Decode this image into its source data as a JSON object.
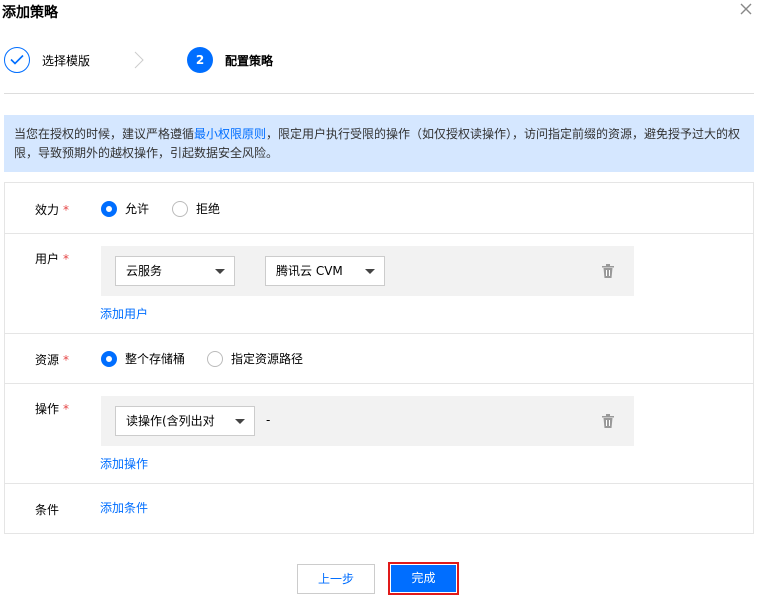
{
  "dialog": {
    "title": "添加策略",
    "close_icon": "close-icon"
  },
  "steps": [
    {
      "label": "选择模版",
      "state": "done",
      "icon": "check-icon"
    },
    {
      "number": "2",
      "label": "配置策略",
      "state": "active"
    }
  ],
  "notice": {
    "prefix": "当您在授权的时候，建议严格遵循",
    "link": "最小权限原则",
    "suffix": "，限定用户执行受限的操作（如仅授权读操作），访问指定前缀的资源，避免授予过大的权限，导致预期外的越权操作，引起数据安全风险。"
  },
  "form": {
    "effect": {
      "label": "效力",
      "required_mark": "*",
      "options": [
        {
          "label": "允许",
          "selected": true
        },
        {
          "label": "拒绝",
          "selected": false
        }
      ]
    },
    "user": {
      "label": "用户",
      "required_mark": "*",
      "select1": "云服务",
      "select2": "腾讯云 CVM",
      "add_link": "添加用户",
      "delete_icon": "trash-icon"
    },
    "resource": {
      "label": "资源",
      "required_mark": "*",
      "options": [
        {
          "label": "整个存储桶",
          "selected": true
        },
        {
          "label": "指定资源路径",
          "selected": false
        }
      ]
    },
    "action": {
      "label": "操作",
      "required_mark": "*",
      "select": "读操作(含列出对",
      "dash": "-",
      "add_link": "添加操作",
      "delete_icon": "trash-icon"
    },
    "condition": {
      "label": "条件",
      "add_link": "添加条件"
    }
  },
  "footer": {
    "prev_label": "上一步",
    "done_label": "完成"
  },
  "colors": {
    "accent": "#006eff",
    "notice_bg": "#d5e7ff",
    "required": "#e54545",
    "highlight_outline": "#e01a1a"
  }
}
